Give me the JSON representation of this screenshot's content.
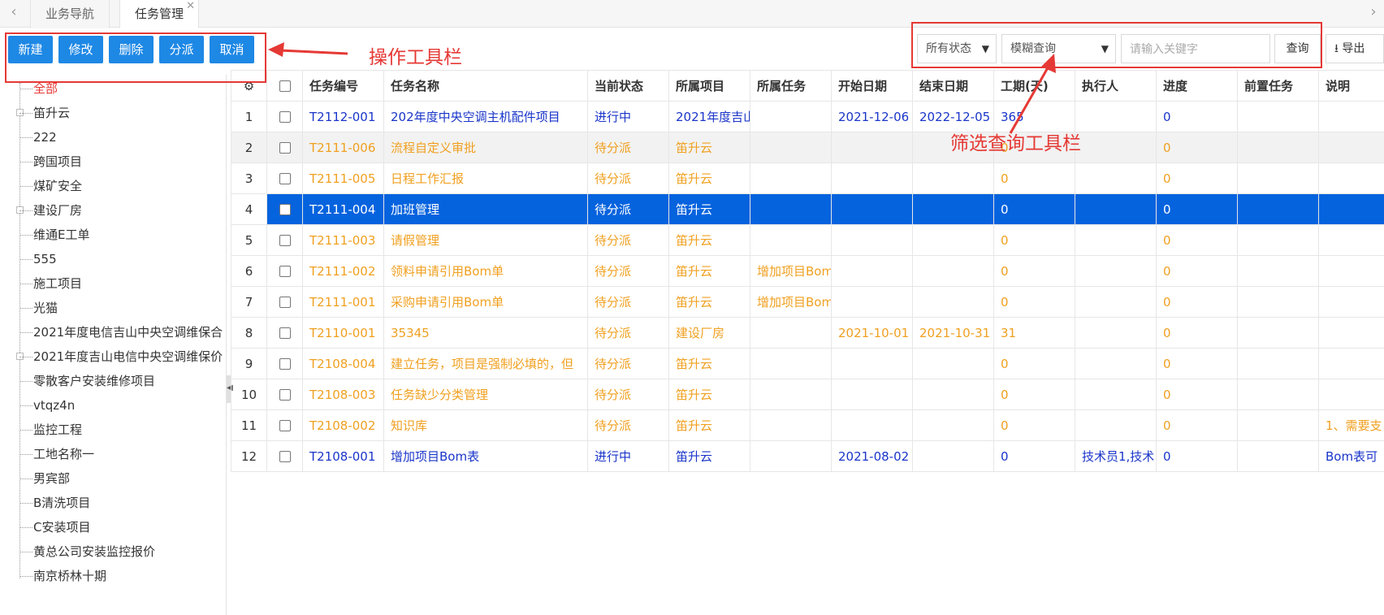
{
  "tabs": [
    {
      "label": "业务导航"
    },
    {
      "label": "任务管理"
    }
  ],
  "toolbar": {
    "new": "新建",
    "edit": "修改",
    "delete": "删除",
    "assign": "分派",
    "cancel": "取消"
  },
  "annotations": {
    "actions": "操作工具栏",
    "filter": "筛选查询工具栏"
  },
  "filter": {
    "status": "所有状态",
    "mode": "模糊查询",
    "keyword_placeholder": "请输入关键字",
    "query": "查询",
    "export": "导出"
  },
  "tree": [
    {
      "label": "全部",
      "selected": true
    },
    {
      "label": "笛升云",
      "expandable": true
    },
    {
      "label": "222"
    },
    {
      "label": "跨国项目"
    },
    {
      "label": "煤矿安全"
    },
    {
      "label": "建设厂房",
      "expandable": true
    },
    {
      "label": "维通E工单"
    },
    {
      "label": "555"
    },
    {
      "label": "施工项目"
    },
    {
      "label": "光猫"
    },
    {
      "label": "2021年度电信吉山中央空调维保合"
    },
    {
      "label": "2021年度吉山电信中央空调维保价",
      "expandable": true
    },
    {
      "label": "零散客户安装维修项目"
    },
    {
      "label": "vtqz4n"
    },
    {
      "label": "监控工程"
    },
    {
      "label": "工地名称一"
    },
    {
      "label": "男宾部"
    },
    {
      "label": "B清洗项目"
    },
    {
      "label": "C安装项目"
    },
    {
      "label": "黄总公司安装监控报价"
    },
    {
      "label": "南京桥林十期"
    }
  ],
  "columns": [
    "任务编号",
    "任务名称",
    "当前状态",
    "所属项目",
    "所属任务",
    "开始日期",
    "结束日期",
    "工期(天)",
    "执行人",
    "进度",
    "前置任务",
    "说明"
  ],
  "rows": [
    {
      "n": "1",
      "cls": "blue",
      "cells": [
        "T2112-001",
        "202年度中央空调主机配件项目",
        "进行中",
        "2021年度吉山",
        "",
        "2021-12-06",
        "2022-12-05",
        "365",
        "",
        "0",
        "",
        ""
      ]
    },
    {
      "n": "2",
      "cls": "orange alt",
      "cells": [
        "T2111-006",
        "流程自定义审批",
        "待分派",
        "笛升云",
        "",
        "",
        "",
        "0",
        "",
        "0",
        "",
        ""
      ]
    },
    {
      "n": "3",
      "cls": "orange",
      "cells": [
        "T2111-005",
        "日程工作汇报",
        "待分派",
        "笛升云",
        "",
        "",
        "",
        "0",
        "",
        "0",
        "",
        ""
      ]
    },
    {
      "n": "4",
      "cls": "selected",
      "cells": [
        "T2111-004",
        "加班管理",
        "待分派",
        "笛升云",
        "",
        "",
        "",
        "0",
        "",
        "0",
        "",
        ""
      ]
    },
    {
      "n": "5",
      "cls": "orange",
      "cells": [
        "T2111-003",
        "请假管理",
        "待分派",
        "笛升云",
        "",
        "",
        "",
        "0",
        "",
        "0",
        "",
        ""
      ]
    },
    {
      "n": "6",
      "cls": "orange",
      "cells": [
        "T2111-002",
        "领料申请引用Bom单",
        "待分派",
        "笛升云",
        "增加项目Bom",
        "",
        "",
        "0",
        "",
        "0",
        "",
        ""
      ]
    },
    {
      "n": "7",
      "cls": "orange",
      "cells": [
        "T2111-001",
        "采购申请引用Bom单",
        "待分派",
        "笛升云",
        "增加项目Bom",
        "",
        "",
        "0",
        "",
        "0",
        "",
        ""
      ]
    },
    {
      "n": "8",
      "cls": "orange",
      "cells": [
        "T2110-001",
        "35345",
        "待分派",
        "建设厂房",
        "",
        "2021-10-01",
        "2021-10-31",
        "31",
        "",
        "0",
        "",
        ""
      ]
    },
    {
      "n": "9",
      "cls": "orange",
      "cells": [
        "T2108-004",
        "建立任务，项目是强制必填的，但",
        "待分派",
        "笛升云",
        "",
        "",
        "",
        "0",
        "",
        "0",
        "",
        ""
      ]
    },
    {
      "n": "10",
      "cls": "orange",
      "cells": [
        "T2108-003",
        "任务缺少分类管理",
        "待分派",
        "笛升云",
        "",
        "",
        "",
        "0",
        "",
        "0",
        "",
        ""
      ]
    },
    {
      "n": "11",
      "cls": "orange",
      "cells": [
        "T2108-002",
        "知识库",
        "待分派",
        "笛升云",
        "",
        "",
        "",
        "0",
        "",
        "0",
        "",
        "1、需要支"
      ]
    },
    {
      "n": "12",
      "cls": "blue",
      "cells": [
        "T2108-001",
        "增加项目Bom表",
        "进行中",
        "笛升云",
        "",
        "2021-08-02",
        "",
        "0",
        "技术员1,技术",
        "0",
        "",
        "Bom表可"
      ]
    }
  ]
}
